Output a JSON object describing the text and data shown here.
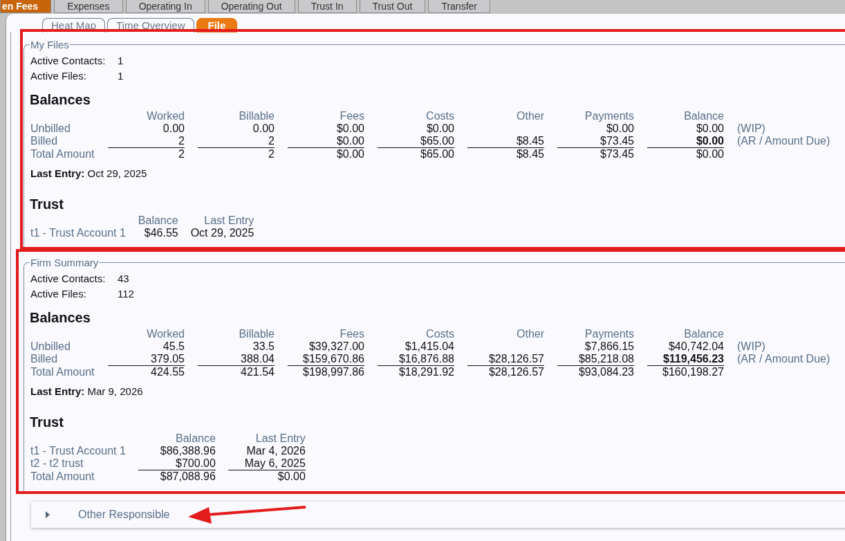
{
  "top_tabs": [
    {
      "label": "en Fees",
      "selected": true
    },
    {
      "label": "Expenses",
      "selected": false
    },
    {
      "label": "Operating In",
      "selected": false
    },
    {
      "label": "Operating Out",
      "selected": false
    },
    {
      "label": "Trust In",
      "selected": false
    },
    {
      "label": "Trust Out",
      "selected": false
    },
    {
      "label": "Transfer",
      "selected": false
    }
  ],
  "sub_tabs": [
    {
      "label": "Heat Map",
      "selected": false
    },
    {
      "label": "Time Overview",
      "selected": false
    },
    {
      "label": "File",
      "selected": true
    }
  ],
  "sections": [
    {
      "title": "My Files",
      "stats": [
        {
          "label": "Active Contacts:",
          "value": "1"
        },
        {
          "label": "Active Files:",
          "value": "1"
        }
      ],
      "balances": {
        "title": "Balances",
        "columns": [
          "Worked",
          "Billable",
          "Fees",
          "Costs",
          "Other",
          "Payments",
          "Balance"
        ],
        "rows": [
          {
            "label": "Unbilled",
            "kind": "item",
            "bold_last": false,
            "worked": "0.00",
            "billable": "0.00",
            "fees": "$0.00",
            "costs": "$0.00",
            "payments": "$0.00",
            "balance": "$0.00",
            "note": "(WIP)"
          },
          {
            "label": "Billed",
            "kind": "last",
            "bold_last": true,
            "worked": "2",
            "billable": "2",
            "fees": "$0.00",
            "costs": "$65.00",
            "other": "$8.45",
            "payments": "$73.45",
            "balance": "$0.00",
            "note": "(AR / Amount Due)"
          },
          {
            "label": "Total Amount",
            "kind": "total",
            "bold_last": false,
            "worked": "2",
            "billable": "2",
            "fees": "$0.00",
            "costs": "$65.00",
            "other": "$8.45",
            "payments": "$73.45",
            "balance": "$0.00"
          }
        ],
        "last_entry": {
          "label": "Last Entry:",
          "value": "Oct 29, 2025"
        }
      },
      "trust": {
        "title": "Trust",
        "columns": [
          "Balance",
          "Last Entry"
        ],
        "rows": [
          {
            "label": "t1 - Trust Account 1",
            "kind": "item",
            "values": [
              "$46.55",
              "Oct 29, 2025"
            ]
          }
        ]
      }
    },
    {
      "title": "Firm Summary",
      "stats": [
        {
          "label": "Active Contacts:",
          "value": "43"
        },
        {
          "label": "Active Files:",
          "value": "112"
        }
      ],
      "balances": {
        "title": "Balances",
        "columns": [
          "Worked",
          "Billable",
          "Fees",
          "Costs",
          "Other",
          "Payments",
          "Balance"
        ],
        "rows": [
          {
            "label": "Unbilled",
            "kind": "item",
            "bold_last": false,
            "worked": "45.5",
            "billable": "33.5",
            "fees": "$39,327.00",
            "costs": "$1,415.04",
            "payments": "$7,866.15",
            "balance": "$40,742.04",
            "note": "(WIP)"
          },
          {
            "label": "Billed",
            "kind": "last",
            "bold_last": true,
            "worked": "379.05",
            "billable": "388.04",
            "fees": "$159,670.86",
            "costs": "$16,876.88",
            "other": "$28,126.57",
            "payments": "$85,218.08",
            "balance": "$119,456.23",
            "note": "(AR / Amount Due)"
          },
          {
            "label": "Total Amount",
            "kind": "total",
            "bold_last": false,
            "worked": "424.55",
            "billable": "421.54",
            "fees": "$198,997.86",
            "costs": "$18,291.92",
            "other": "$28,126.57",
            "payments": "$93,084.23",
            "balance": "$160,198.27"
          }
        ],
        "last_entry": {
          "label": "Last Entry:",
          "value": "Mar 9, 2026"
        }
      },
      "trust": {
        "title": "Trust",
        "columns": [
          "Balance",
          "Last Entry"
        ],
        "rows": [
          {
            "label": "t1 - Trust Account 1",
            "kind": "item",
            "values": [
              "$86,388.96",
              "Mar 4, 2026"
            ]
          },
          {
            "label": "t2 - t2 trust",
            "kind": "last",
            "values": [
              "$700.00",
              "May 6, 2025"
            ]
          },
          {
            "label": "Total Amount",
            "kind": "total",
            "values": [
              "$87,088.96",
              "$0.00"
            ]
          }
        ]
      }
    }
  ],
  "collapsible": {
    "label": "Other Responsible",
    "expanded": false
  }
}
